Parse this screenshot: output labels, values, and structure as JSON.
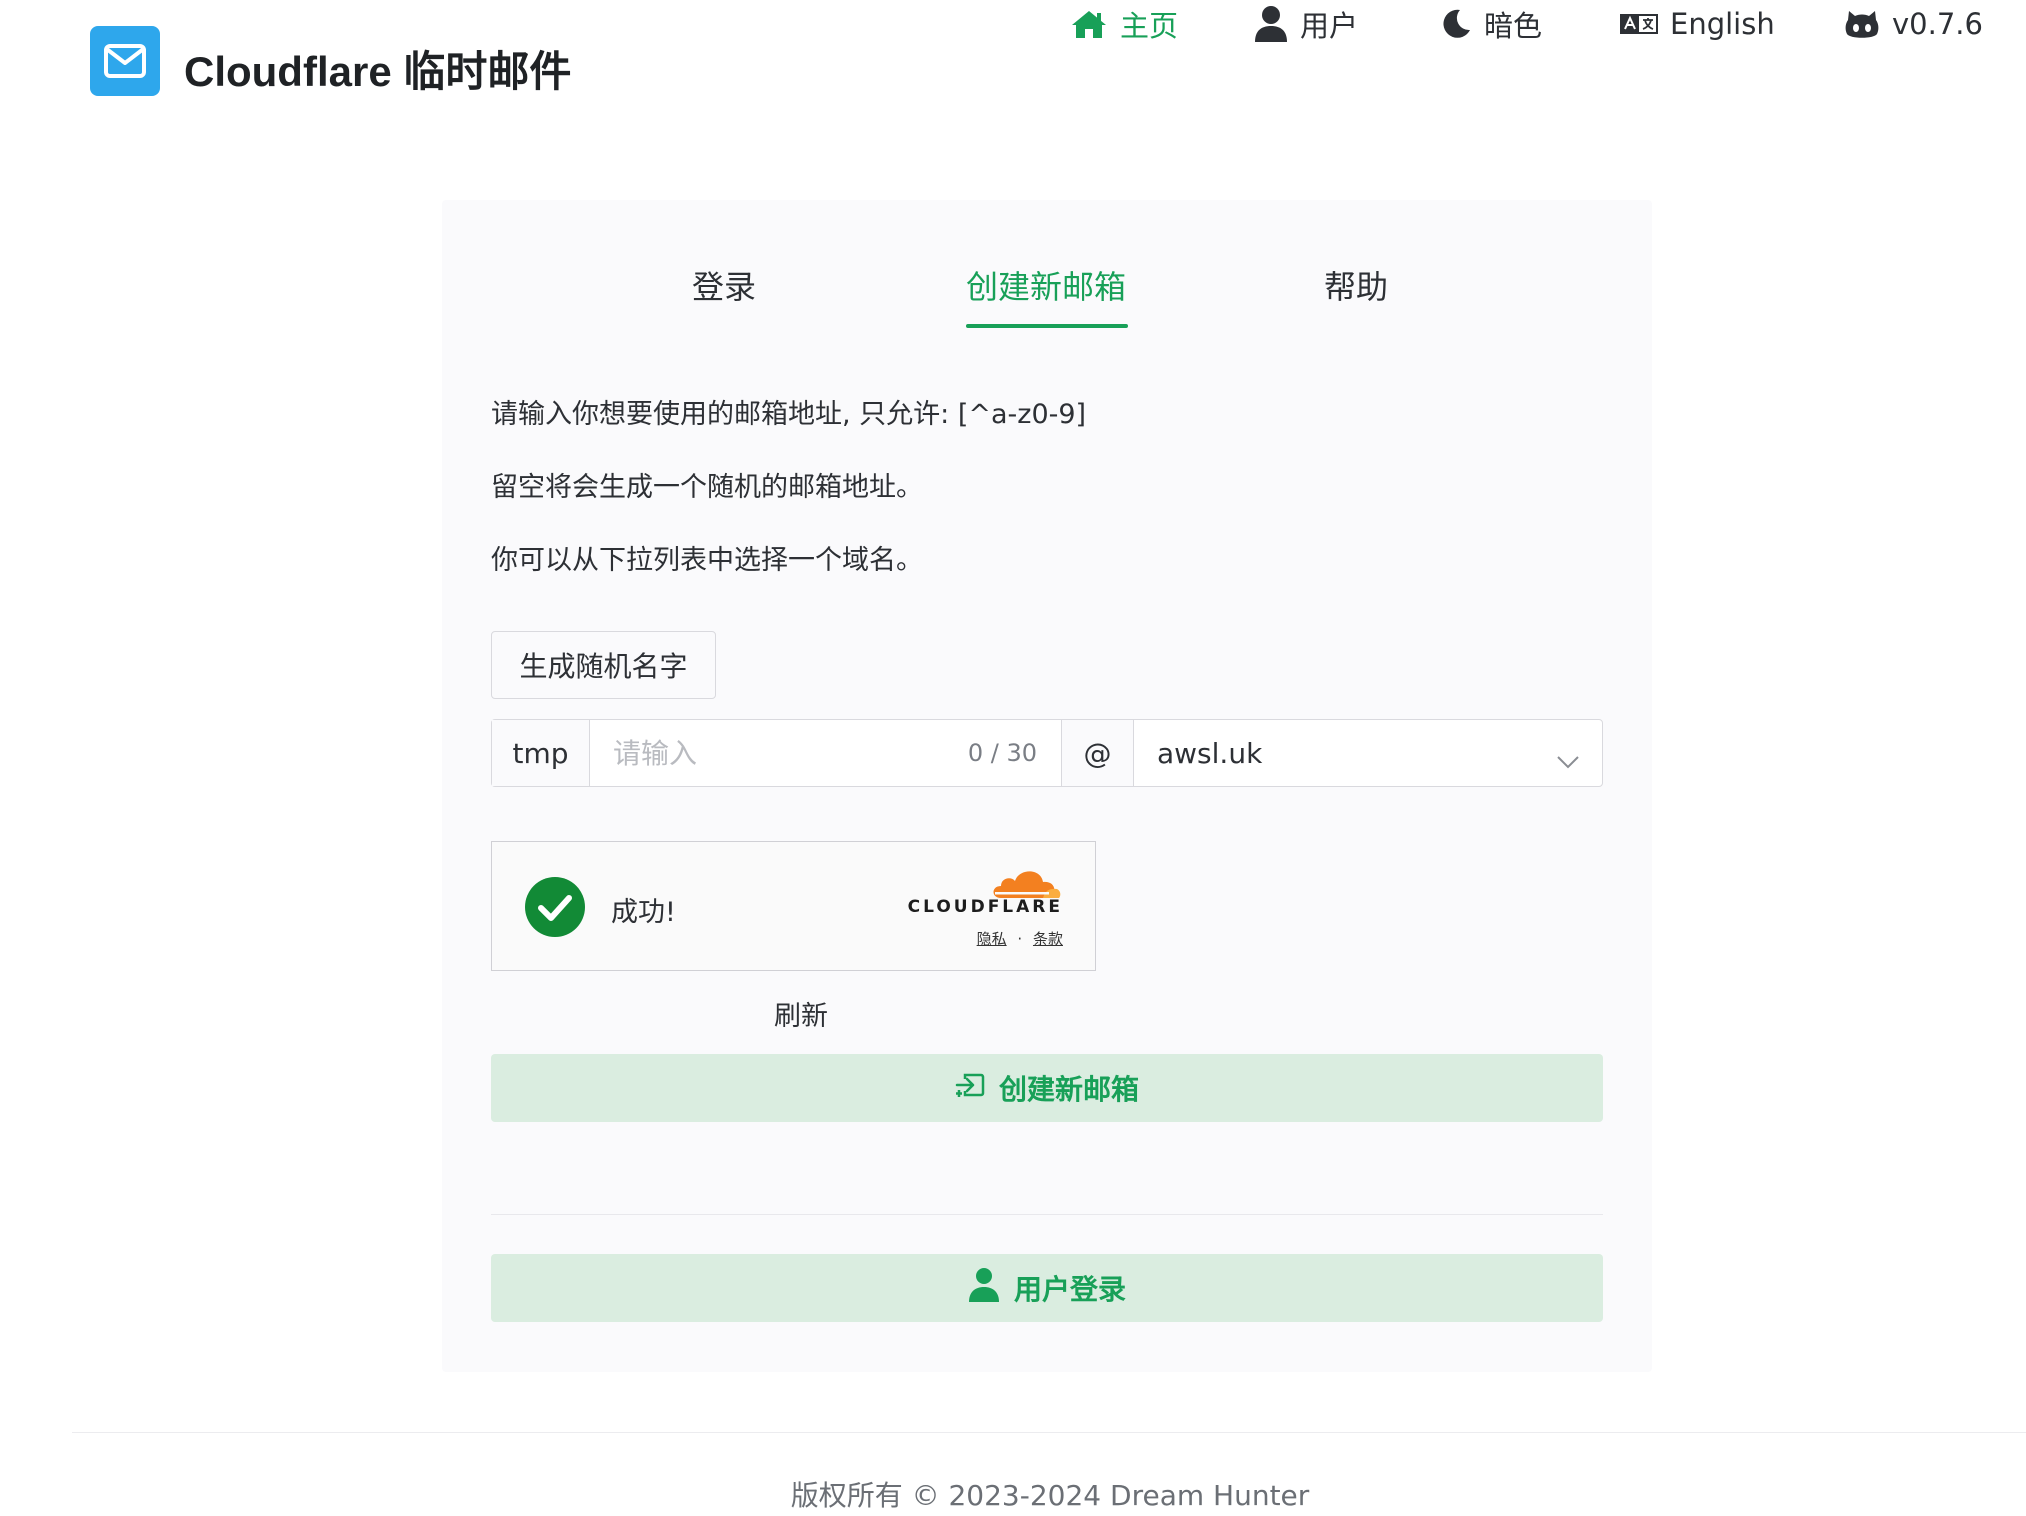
{
  "header": {
    "brand": "Cloudflare 临时邮件",
    "nav": {
      "home": "主页",
      "user": "用户",
      "dark": "暗色",
      "language": "English",
      "version": "v0.7.6"
    }
  },
  "tabs": {
    "login": "登录",
    "create": "创建新邮箱",
    "help": "帮助"
  },
  "description": {
    "line1": "请输入你想要使用的邮箱地址, 只允许: [^a-z0-9]",
    "line2": "留空将会生成一个随机的邮箱地址。",
    "line3": "你可以从下拉列表中选择一个域名。"
  },
  "form": {
    "random_button": "生成随机名字",
    "prefix": "tmp",
    "name_value": "",
    "name_placeholder": "请输入",
    "counter": "0 / 30",
    "at": "@",
    "domain": "awsl.uk"
  },
  "captcha": {
    "status": "成功!",
    "brand": "CLOUDFLARE",
    "privacy": "隐私",
    "separator": "·",
    "terms": "条款",
    "refresh": "刷新"
  },
  "actions": {
    "create_button": "创建新邮箱",
    "user_login_button": "用户登录"
  },
  "footer": {
    "copyright": "版权所有 © 2023-2024 Dream Hunter"
  },
  "colors": {
    "accent": "#18a058",
    "logo_bg": "#2ea7ec",
    "button_green_bg": "#daede0",
    "cloudflare_orange": "#f38020"
  }
}
